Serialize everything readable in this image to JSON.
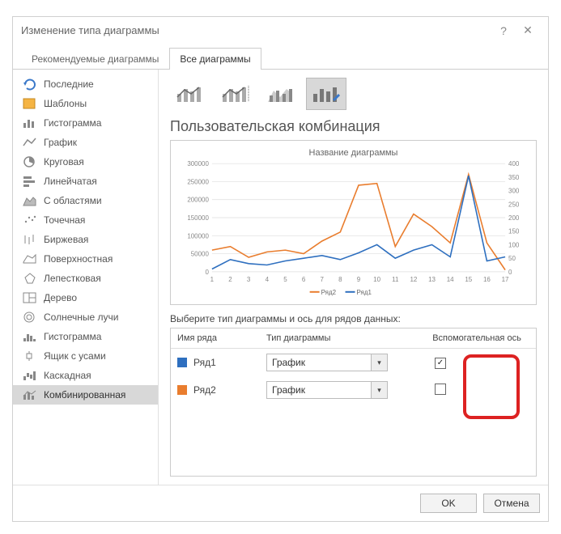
{
  "window": {
    "title": "Изменение типа диаграммы"
  },
  "tabs": {
    "recommended": "Рекомендуемые диаграммы",
    "all": "Все диаграммы"
  },
  "sidebar": {
    "items": [
      {
        "label": "Последние"
      },
      {
        "label": "Шаблоны"
      },
      {
        "label": "Гистограмма"
      },
      {
        "label": "График"
      },
      {
        "label": "Круговая"
      },
      {
        "label": "Линейчатая"
      },
      {
        "label": "С областями"
      },
      {
        "label": "Точечная"
      },
      {
        "label": "Биржевая"
      },
      {
        "label": "Поверхностная"
      },
      {
        "label": "Лепестковая"
      },
      {
        "label": "Дерево"
      },
      {
        "label": "Солнечные лучи"
      },
      {
        "label": "Гистограмма"
      },
      {
        "label": "Ящик с усами"
      },
      {
        "label": "Каскадная"
      },
      {
        "label": "Комбинированная"
      }
    ]
  },
  "main": {
    "title": "Пользовательская комбинация",
    "preview": {
      "chart_title": "Название диаграммы",
      "legend": {
        "s1": "Ряд2",
        "s2": "Ряд1"
      }
    },
    "series_label": "Выберите тип диаграммы и ось для рядов данных:",
    "headers": {
      "name": "Имя ряда",
      "type": "Тип диаграммы",
      "aux": "Вспомогательная ось"
    },
    "rows": [
      {
        "name": "Ряд1",
        "color": "#2e6fbf",
        "type": "График",
        "aux": true
      },
      {
        "name": "Ряд2",
        "color": "#e97d2e",
        "type": "График",
        "aux": false
      }
    ]
  },
  "footer": {
    "ok": "OK",
    "cancel": "Отмена"
  },
  "chart_data": {
    "type": "line",
    "title": "Название диаграммы",
    "x": [
      1,
      2,
      3,
      4,
      5,
      6,
      7,
      8,
      9,
      10,
      11,
      12,
      13,
      14,
      15,
      16,
      17
    ],
    "y1": {
      "label": "",
      "ticks": [
        0,
        50000,
        100000,
        150000,
        200000,
        250000,
        300000
      ],
      "range": [
        0,
        300000
      ]
    },
    "y2": {
      "label": "",
      "ticks": [
        0,
        50,
        100,
        150,
        200,
        250,
        300,
        350,
        400
      ],
      "range": [
        0,
        400
      ]
    },
    "series": [
      {
        "name": "Ряд2",
        "axis": "y1",
        "color": "#e97d2e",
        "values": [
          60000,
          70000,
          40000,
          55000,
          60000,
          50000,
          85000,
          110000,
          240000,
          245000,
          70000,
          160000,
          125000,
          80000,
          270000,
          80000,
          5000
        ]
      },
      {
        "name": "Ряд1",
        "axis": "y2",
        "color": "#2e6fbf",
        "values": [
          10,
          45,
          30,
          25,
          40,
          50,
          60,
          45,
          70,
          100,
          50,
          80,
          100,
          55,
          355,
          40,
          55
        ]
      }
    ],
    "legend_position": "bottom",
    "grid": true
  }
}
